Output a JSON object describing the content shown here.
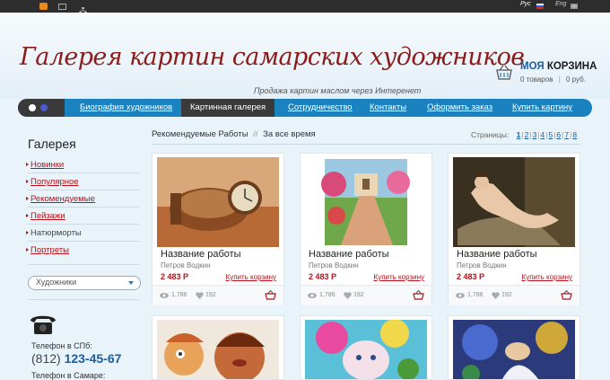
{
  "topbar": {
    "lang_ru": "Рус",
    "lang_en": "Eng"
  },
  "header": {
    "logo": "Галерея картин самарских художников",
    "slogan": "Продажа картин маслом через Интеренет",
    "cart_title_part1": "МОЯ",
    "cart_title_part2": "КОРЗИНА",
    "cart_items": "0 товаров",
    "cart_sum": "0 руб."
  },
  "nav": {
    "items": [
      "Биография художников",
      "Картинная галерея",
      "Сотрудничество",
      "Контакты",
      "Оформить заказ",
      "Купить картину"
    ],
    "active": "Картинная галерея"
  },
  "sidebar": {
    "title": "Галерея",
    "items": [
      "Новинки",
      "Популярное",
      "Рекомендуемые",
      "Пейзажи",
      "Натюрморты",
      "Портреты"
    ],
    "artists_select": "Художники",
    "phone_label": "Телефон в СПб:",
    "phone_code": "(812)",
    "phone_number": "123-45-67",
    "phone_label2": "Телефон в Самаре:"
  },
  "content": {
    "filter_recommended": "Рекомендуемые Работы",
    "filter_sep": "//",
    "filter_all_time": "За все время",
    "pages_label": "Страницы:",
    "pages": [
      "1",
      "2",
      "3",
      "4",
      "5",
      "6",
      "7",
      "8"
    ],
    "current_page": "1"
  },
  "products": [
    {
      "title": "Название работы",
      "author": "Петров Водкин",
      "price": "2 483 Р",
      "buy": "Купить корзину",
      "views": "1,786",
      "likes": "192"
    },
    {
      "title": "Название работы",
      "author": "Петров Водкин",
      "price": "2 483 Р",
      "buy": "Купить корзину",
      "views": "1,786",
      "likes": "192"
    },
    {
      "title": "Название работы",
      "author": "Петров Водкин",
      "price": "2 483 Р",
      "buy": "Купить корзину",
      "views": "1,786",
      "likes": "192"
    }
  ],
  "colors": {
    "accent_blue": "#1b82c0",
    "brand_red": "#b5121b",
    "logo_red": "#8a1c1c"
  },
  "icons": [
    "rss-icon",
    "mail-icon",
    "sitemap-icon",
    "russian-flag-icon",
    "uk-flag-icon",
    "cart-icon",
    "phone-icon",
    "eye-icon",
    "heart-icon",
    "basket-icon"
  ]
}
